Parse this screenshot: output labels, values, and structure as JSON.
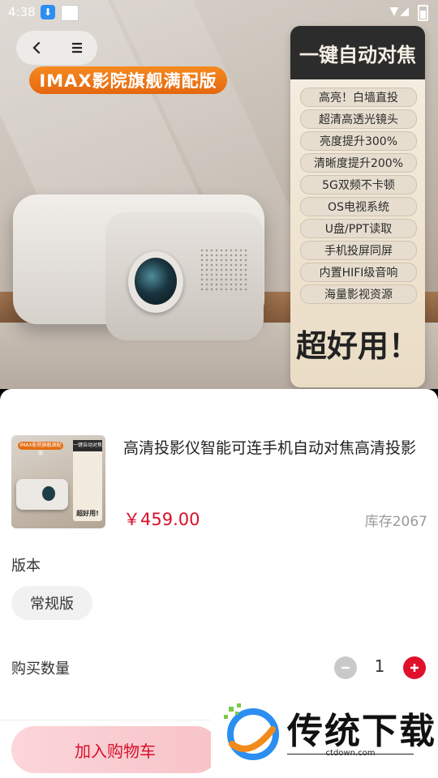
{
  "status_bar": {
    "time": "4:38"
  },
  "hero": {
    "badge": "IMAX影院旗舰满配版",
    "panel_title": "一键自动对焦",
    "features": [
      "高亮！白墙直投",
      "超清高透光镜头",
      "亮度提升300%",
      "清晰度提升200%",
      "5G双频不卡顿",
      "OS电视系统",
      "U盘/PPT读取",
      "手机投屏同屏",
      "内置HIFI级音响",
      "海量影视资源"
    ],
    "panel_footer": "超好用！"
  },
  "nav": {
    "back_icon": "chevron-left-icon",
    "menu_icon": "menu-icon"
  },
  "thumbnail": {
    "badge": "IMAX影院旗舰满配版",
    "panel_title": "一键自动对焦",
    "panel_footer": "超好用!"
  },
  "product": {
    "title": "高清投影仪智能可连手机自动对焦高清投影",
    "price": "￥459.00",
    "stock": "库存2067"
  },
  "version": {
    "label": "版本",
    "selected": "常规版"
  },
  "quantity": {
    "label": "购买数量",
    "value": "1"
  },
  "actions": {
    "add_to_cart": "加入购物车"
  },
  "watermark": {
    "brand": "传统下载",
    "url": "ctdown.com"
  },
  "colors": {
    "accent": "#d8102a",
    "badge_orange": "#e46710"
  }
}
